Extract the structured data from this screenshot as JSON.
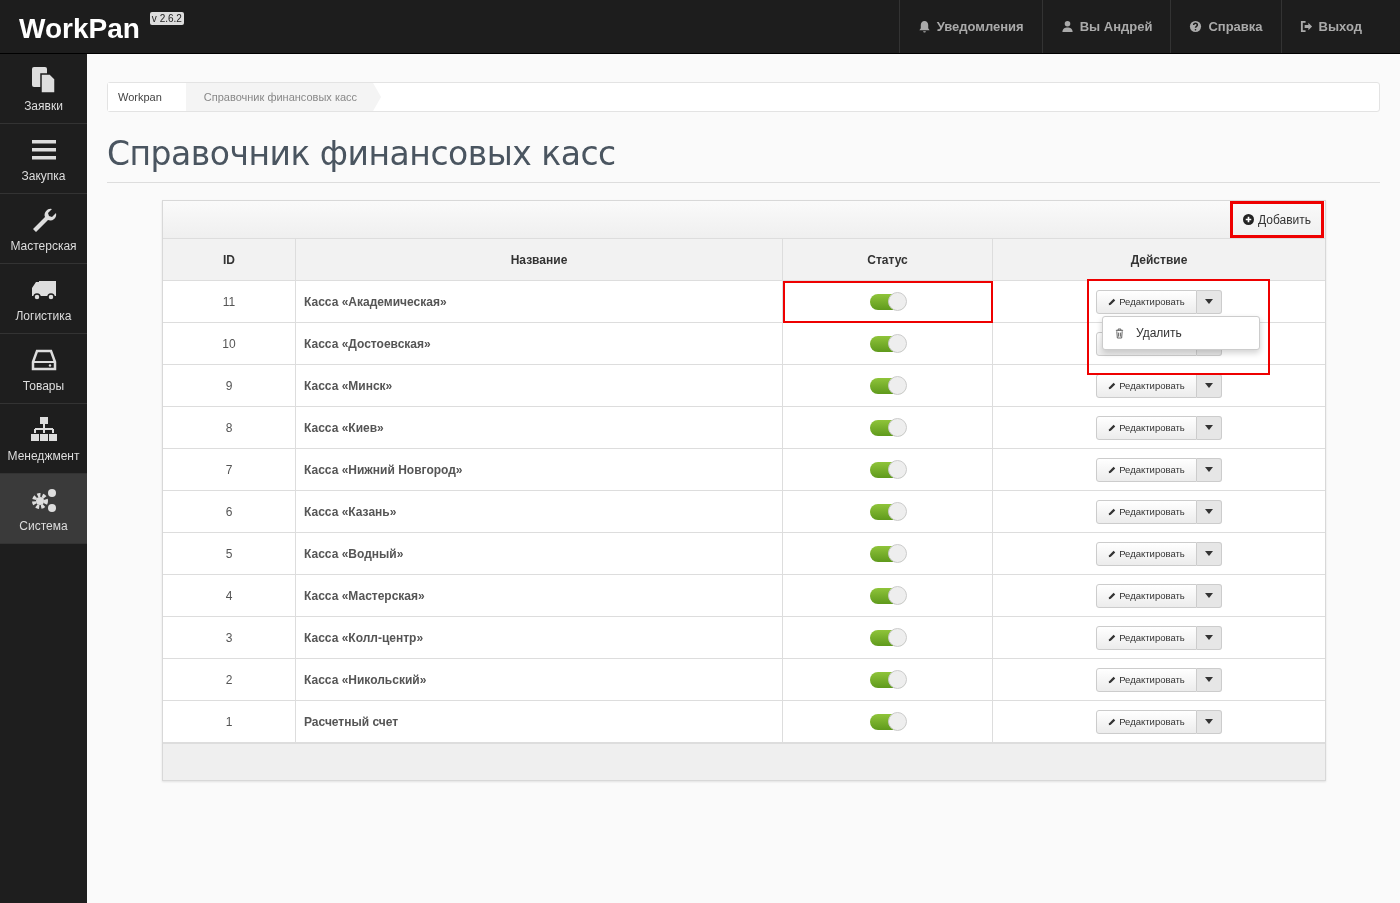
{
  "topbar": {
    "logo": "WorkPan",
    "version": "v 2.6.2",
    "nav": [
      {
        "label": "Уведомления"
      },
      {
        "label": "Вы Андрей"
      },
      {
        "label": "Справка"
      },
      {
        "label": "Выход"
      }
    ]
  },
  "sidebar": {
    "items": [
      {
        "label": "Заявки",
        "selected": false
      },
      {
        "label": "Закупка",
        "selected": false
      },
      {
        "label": "Мастерская",
        "selected": false
      },
      {
        "label": "Логистика",
        "selected": false
      },
      {
        "label": "Товары",
        "selected": false
      },
      {
        "label": "Менеджмент",
        "selected": false
      },
      {
        "label": "Система",
        "selected": true
      }
    ]
  },
  "breadcrumb": [
    "Workpan",
    "Справочник финансовых касс"
  ],
  "title": "Справочник финансовых касс",
  "panel": {
    "add_button": {
      "label": "Добавить",
      "highlighted": true
    },
    "columns": [
      "ID",
      "Название",
      "Статус",
      "Действие"
    ],
    "rows": [
      {
        "id": "11",
        "name": "Касса «Академическая»",
        "on": true,
        "action": "Редактировать",
        "highlighted": true,
        "menu": [
          {
            "label": "Удалить"
          }
        ]
      },
      {
        "id": "10",
        "name": "Касса «Достоевская»",
        "on": true
      },
      {
        "id": "9",
        "name": "Касса «Минск»",
        "on": true,
        "action": "Редактировать"
      },
      {
        "id": "8",
        "name": "Касса «Киев»",
        "on": true,
        "action": "Редактировать"
      },
      {
        "id": "7",
        "name": "Касса «Нижний Новгород»",
        "on": true,
        "action": "Редактировать"
      },
      {
        "id": "6",
        "name": "Касса «Казань»",
        "on": true,
        "action": "Редактировать"
      },
      {
        "id": "5",
        "name": "Касса «Водный»",
        "on": true,
        "action": "Редактировать"
      },
      {
        "id": "4",
        "name": "Касса «Мастерская»",
        "on": true,
        "action": "Редактировать"
      },
      {
        "id": "3",
        "name": "Касса «Колл-центр»",
        "on": true,
        "action": "Редактировать"
      },
      {
        "id": "2",
        "name": "Касса «Никольский»",
        "on": true,
        "action": "Редактировать"
      },
      {
        "id": "1",
        "name": "Расчетный счет",
        "on": true,
        "action": "Редактировать"
      }
    ]
  }
}
